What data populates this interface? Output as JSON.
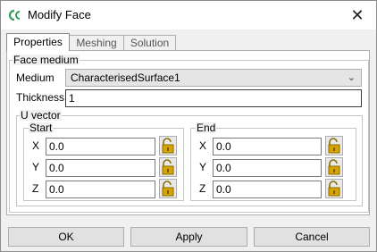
{
  "window": {
    "title": "Modify Face",
    "app_icon": "sc-logo-icon",
    "close_icon": "close-icon",
    "close_glyph": "✕"
  },
  "tabs": [
    {
      "label": "Properties",
      "active": true
    },
    {
      "label": "Meshing",
      "active": false
    },
    {
      "label": "Solution",
      "active": false
    }
  ],
  "face_medium": {
    "legend": "Face medium",
    "medium_label": "Medium",
    "medium_value": "CharacterisedSurface1",
    "thickness_label": "Thickness",
    "thickness_value": "1"
  },
  "u_vector": {
    "legend": "U vector",
    "start": {
      "legend": "Start",
      "x_label": "X",
      "x_value": "0.0",
      "y_label": "Y",
      "y_value": "0.0",
      "z_label": "Z",
      "z_value": "0.0"
    },
    "end": {
      "legend": "End",
      "x_label": "X",
      "x_value": "0.0",
      "y_label": "Y",
      "y_value": "0.0",
      "z_label": "Z",
      "z_value": "0.0"
    },
    "lock_icon": "padlock-open-icon"
  },
  "buttons": {
    "ok": "OK",
    "apply": "Apply",
    "cancel": "Cancel"
  },
  "colors": {
    "lock_gold": "#d9a400",
    "logo_green": "#2f9e5b"
  }
}
